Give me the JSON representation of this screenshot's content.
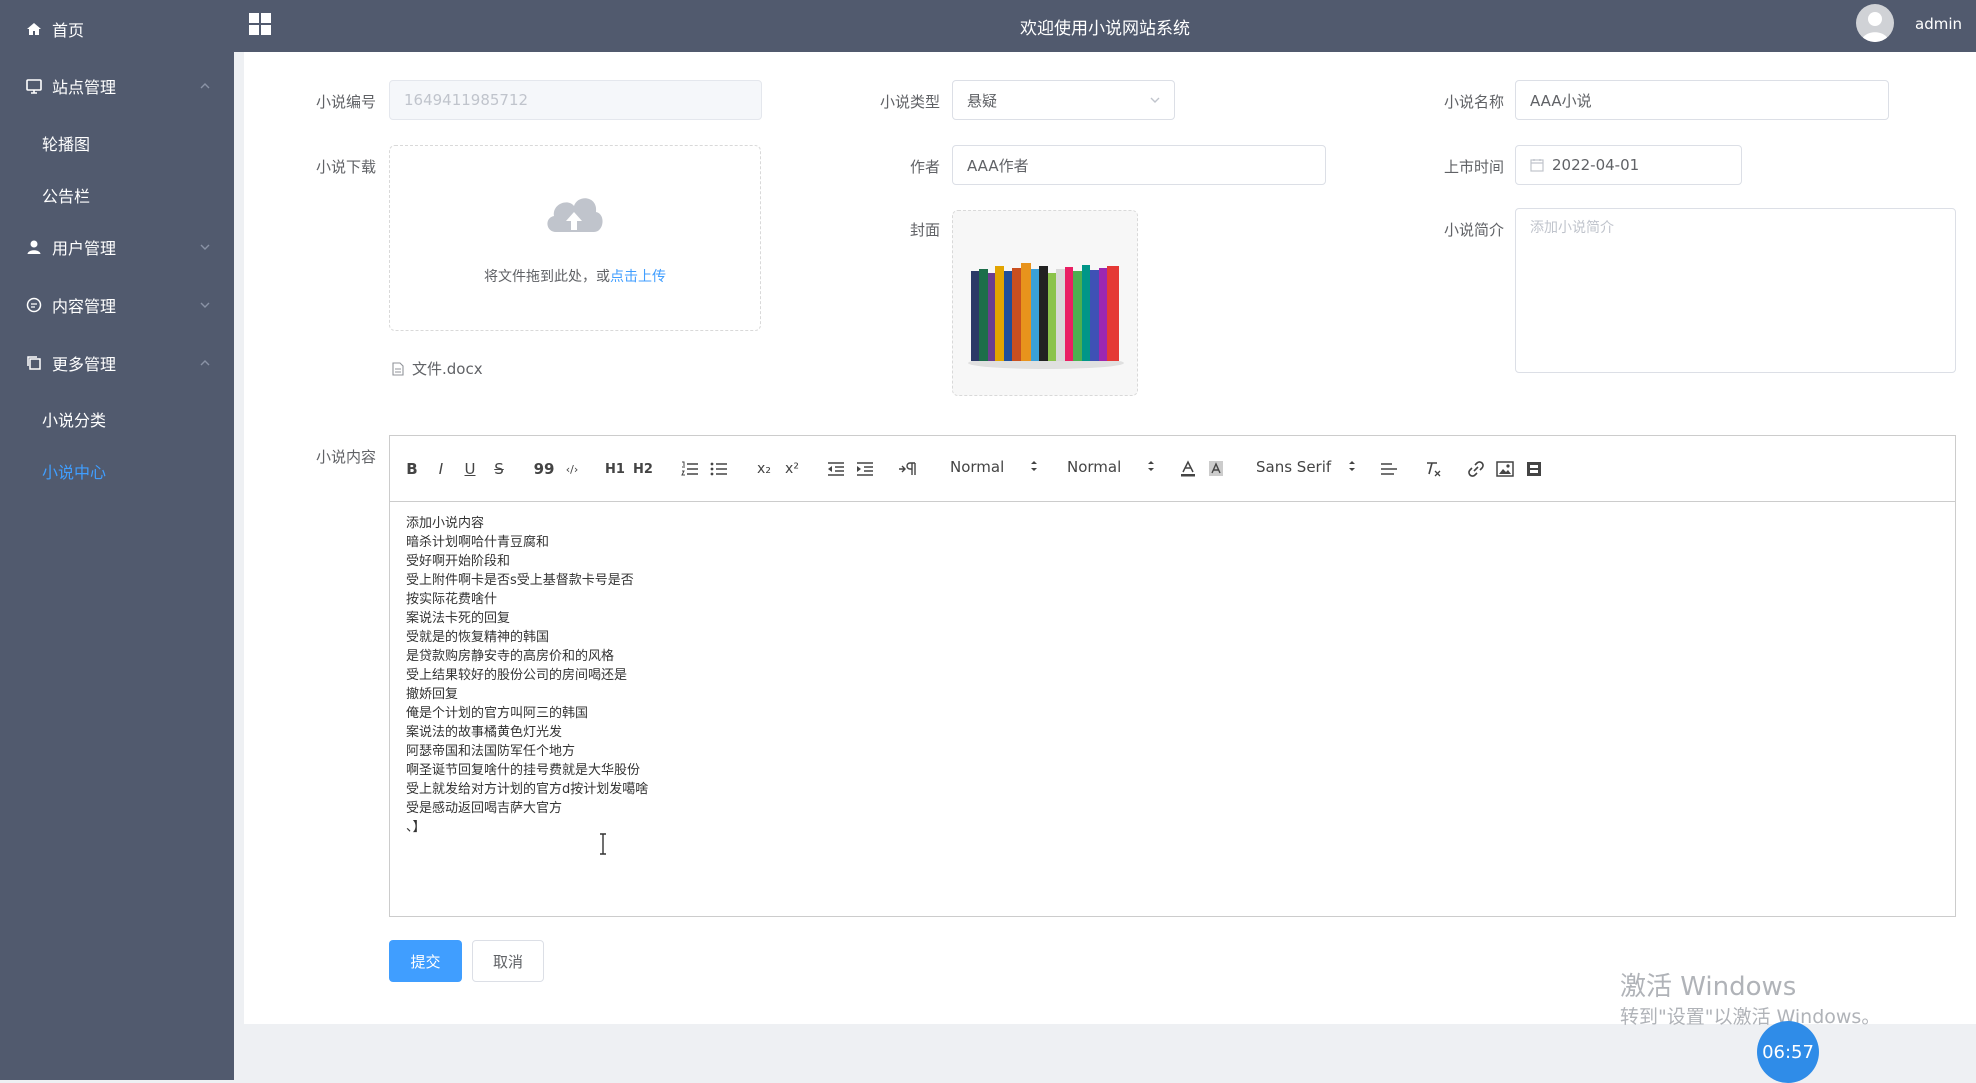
{
  "sidebar": {
    "home": "首页",
    "site_mgmt": "站点管理",
    "carousel": "轮播图",
    "notice": "公告栏",
    "user_mgmt": "用户管理",
    "content_mgmt": "内容管理",
    "more_mgmt": "更多管理",
    "novel_category": "小说分类",
    "novel_center": "小说中心"
  },
  "header": {
    "title": "欢迎使用小说网站系统",
    "user": "admin"
  },
  "form": {
    "novel_no_label": "小说编号",
    "novel_no_value": "1649411985712",
    "type_label": "小说类型",
    "type_value": "悬疑",
    "name_label": "小说名称",
    "name_value": "AAA小说",
    "download_label": "小说下载",
    "upload_hint": "将文件拖到此处，或",
    "upload_link": "点击上传",
    "file_name": "文件.docx",
    "author_label": "作者",
    "author_value": "AAA作者",
    "release_label": "上市时间",
    "release_value": "2022-04-01",
    "cover_label": "封面",
    "intro_label": "小说简介",
    "intro_placeholder": "添加小说简介",
    "content_label": "小说内容"
  },
  "editor": {
    "toolbar": {
      "bold": "B",
      "italic": "I",
      "underline": "U",
      "strike": "S",
      "quote": "99",
      "code": "‹/›",
      "h1": "H1",
      "h2": "H2",
      "sub": "x₂",
      "sup": "x²",
      "size": "Normal",
      "header": "Normal",
      "font": "Sans Serif"
    },
    "content": "添加小说内容\n暗杀计划啊哈什青豆腐和\n受好啊开始阶段和\n受上附件啊卡是否s受上基督款卡号是否\n按实际花费啥什\n案说法卡死的回复\n受就是的恢复精神的韩国\n是贷款购房静安寺的高房价和的风格\n受上结果较好的股份公司的房间喝还是\n撤娇回复\n俺是个计划的官方叫阿三的韩国\n案说法的故事橘黄色灯光发\n阿瑟帝国和法国防军任个地方\n啊圣诞节回复啥什的挂号费就是大华股份\n受上就发给对方计划的官方d按计划发噶啥\n受是感动返回喝吉萨大官方\n、】"
  },
  "buttons": {
    "submit": "提交",
    "cancel": "取消"
  },
  "watermark": {
    "line1": "激活 Windows",
    "line2": "转到\"设置\"以激活 Windows。"
  },
  "timer": "06:57"
}
